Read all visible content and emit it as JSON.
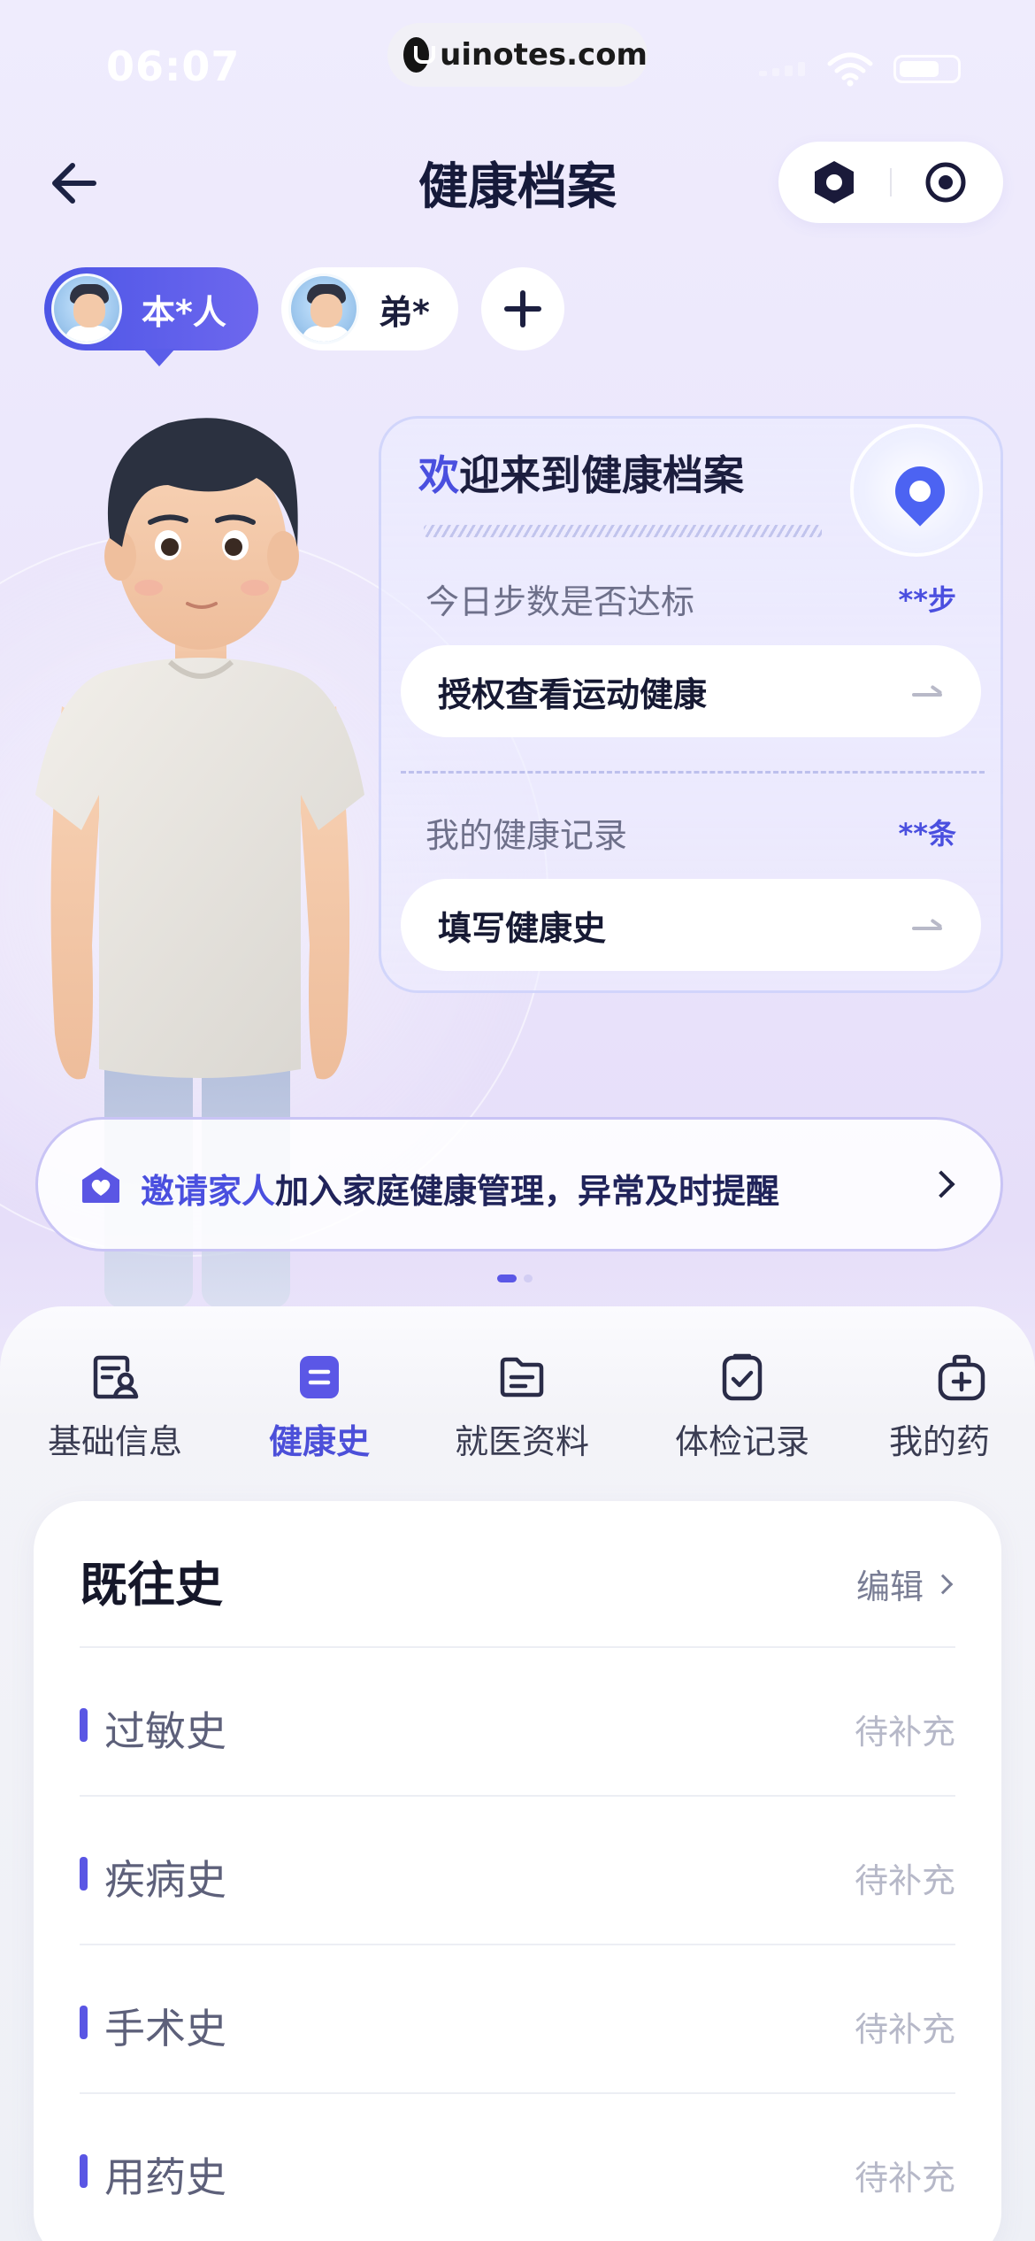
{
  "status_bar": {
    "time": "06:07",
    "url": "uinotes.com"
  },
  "nav": {
    "title": "健康档案"
  },
  "members": [
    {
      "label": "本*人",
      "selected": true
    },
    {
      "label": "弟*",
      "selected": false
    }
  ],
  "welcome": {
    "title_accent": "欢",
    "title_rest": "迎来到健康档案",
    "steps_label": "今日步数是否达标",
    "steps_value": "**步",
    "steps_button": "授权查看运动健康",
    "records_label": "我的健康记录",
    "records_value": "**条",
    "records_button": "填写健康史"
  },
  "invite": {
    "text_accent": "邀请家人",
    "text_rest": "加入家庭健康管理，异常及时提醒"
  },
  "tabs": [
    {
      "label": "基础信息",
      "icon": "profile-doc-icon"
    },
    {
      "label": "健康史",
      "icon": "history-doc-icon",
      "active": true
    },
    {
      "label": "就医资料",
      "icon": "folder-icon"
    },
    {
      "label": "体检记录",
      "icon": "checkup-clipboard-icon"
    },
    {
      "label": "我的药",
      "icon": "medicine-bag-icon"
    }
  ],
  "history_card": {
    "title": "既往史",
    "edit_label": "编辑",
    "rows": [
      {
        "label": "过敏史",
        "status": "待补充"
      },
      {
        "label": "疾病史",
        "status": "待补充"
      },
      {
        "label": "手术史",
        "status": "待补充"
      },
      {
        "label": "用药史",
        "status": "待补充"
      }
    ]
  },
  "colors": {
    "accent": "#4a4fdf",
    "title": "#161a3a",
    "muted": "#b6b8c8"
  }
}
